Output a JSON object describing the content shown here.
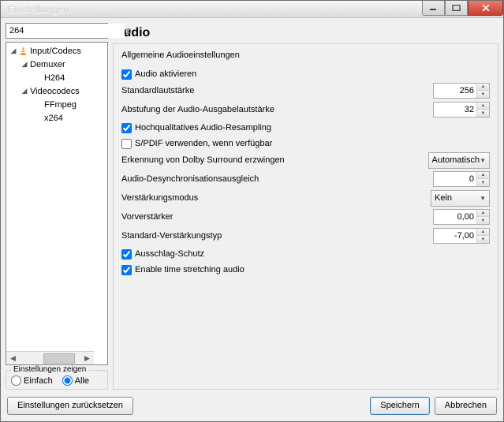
{
  "window": {
    "title": "Einstellungen"
  },
  "search": {
    "value": "264"
  },
  "tree": {
    "items": [
      "Input/Codecs",
      "Demuxer",
      "H264",
      "Videocodecs",
      "FFmpeg",
      "x264"
    ]
  },
  "show_settings": {
    "label": "Einstellungen zeigen",
    "simple": "Einfach",
    "all": "Alle"
  },
  "page": {
    "title": "Audio",
    "group": "Allgemeine Audioeinstellungen",
    "enable_audio": "Audio aktivieren",
    "default_volume": "Standardlautstärke",
    "default_volume_val": "256",
    "step_label": "Abstufung der Audio-Ausgabelautstärke",
    "step_val": "32",
    "hq_resampling": "Hochqualitatives Audio-Resampling",
    "spdif": "S/PDIF verwenden, wenn verfügbar",
    "dolby": "Erkennung von Dolby Surround erzwingen",
    "dolby_val": "Automatisch",
    "desync": "Audio-Desynchronisationsausgleich",
    "desync_val": "0",
    "gain_mode": "Verstärkungsmodus",
    "gain_mode_val": "Kein",
    "preamp": "Vorverstärker",
    "preamp_val": "0,00",
    "std_gain": "Standard-Verstärkungstyp",
    "std_gain_val": "-7,00",
    "clipping": "Ausschlag-Schutz",
    "timestretch": "Enable time stretching audio"
  },
  "buttons": {
    "reset": "Einstellungen zurücksetzen",
    "save": "Speichern",
    "cancel": "Abbrechen"
  }
}
